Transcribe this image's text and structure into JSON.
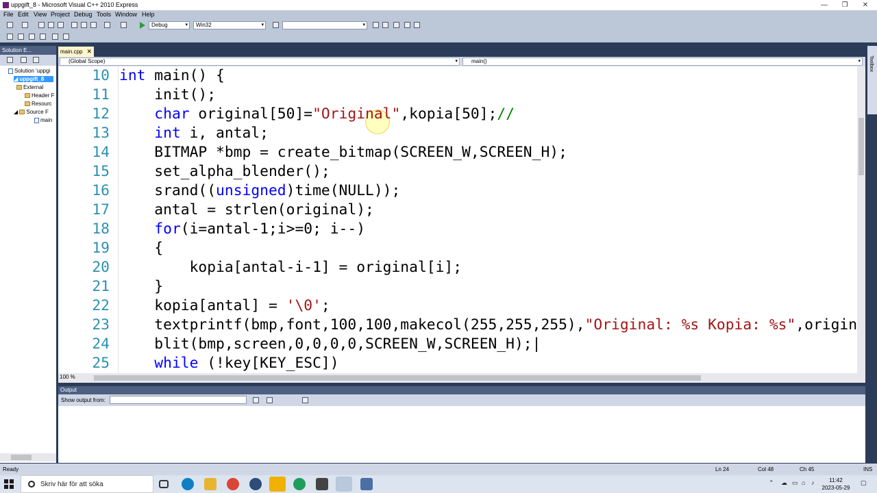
{
  "window": {
    "title": "uppgift_8 - Microsoft Visual C++ 2010 Express",
    "controls": [
      "—",
      "❐",
      "✕"
    ]
  },
  "menu": [
    "File",
    "Edit",
    "View",
    "Project",
    "Debug",
    "Tools",
    "Window",
    "Help"
  ],
  "toolbar": {
    "config": "Debug",
    "platform": "Win32",
    "find_value": ""
  },
  "solution_explorer": {
    "title": "Solution E...",
    "items": [
      {
        "label": "Solution 'uppgi",
        "kind": "solution"
      },
      {
        "label": "uppgift_8",
        "kind": "project"
      },
      {
        "label": "External",
        "kind": "folder"
      },
      {
        "label": "Header F",
        "kind": "folder"
      },
      {
        "label": "Resourc",
        "kind": "folder"
      },
      {
        "label": "Source F",
        "kind": "folder"
      },
      {
        "label": "main",
        "kind": "file"
      }
    ]
  },
  "editor": {
    "tab": "main.cpp",
    "scope": "(Global Scope)",
    "function": "main()",
    "zoom": "100 %",
    "lines": [
      {
        "n": "10",
        "tokens": [
          {
            "t": "int",
            "c": "kw"
          },
          {
            "t": " main() {",
            "c": ""
          }
        ]
      },
      {
        "n": "11",
        "tokens": [
          {
            "t": "    init();",
            "c": ""
          }
        ]
      },
      {
        "n": "12",
        "tokens": [
          {
            "t": "    ",
            "c": ""
          },
          {
            "t": "char",
            "c": "kw"
          },
          {
            "t": " original[50]=",
            "c": ""
          },
          {
            "t": "\"Original\"",
            "c": "str"
          },
          {
            "t": ",kopia[50];",
            "c": ""
          },
          {
            "t": "//",
            "c": "cm"
          }
        ]
      },
      {
        "n": "13",
        "tokens": [
          {
            "t": "    ",
            "c": ""
          },
          {
            "t": "int",
            "c": "kw"
          },
          {
            "t": " i, antal;",
            "c": ""
          }
        ]
      },
      {
        "n": "14",
        "tokens": [
          {
            "t": "    BITMAP *bmp = create_bitmap(SCREEN_W,SCREEN_H);",
            "c": ""
          }
        ]
      },
      {
        "n": "15",
        "tokens": [
          {
            "t": "    set_alpha_blender();",
            "c": ""
          }
        ]
      },
      {
        "n": "16",
        "tokens": [
          {
            "t": "    srand((",
            "c": ""
          },
          {
            "t": "unsigned",
            "c": "kw"
          },
          {
            "t": ")time(NULL));",
            "c": ""
          }
        ]
      },
      {
        "n": "17",
        "tokens": [
          {
            "t": "    antal = strlen(original);",
            "c": ""
          }
        ]
      },
      {
        "n": "18",
        "tokens": [
          {
            "t": "    ",
            "c": ""
          },
          {
            "t": "for",
            "c": "kw"
          },
          {
            "t": "(i=antal-1;i>=0; i--)",
            "c": ""
          }
        ]
      },
      {
        "n": "19",
        "tokens": [
          {
            "t": "    {",
            "c": ""
          }
        ]
      },
      {
        "n": "20",
        "tokens": [
          {
            "t": "        kopia[antal-i-1] = original[i];",
            "c": ""
          }
        ]
      },
      {
        "n": "21",
        "tokens": [
          {
            "t": "    }",
            "c": ""
          }
        ]
      },
      {
        "n": "22",
        "tokens": [
          {
            "t": "    kopia[antal] = ",
            "c": ""
          },
          {
            "t": "'\\0'",
            "c": "str"
          },
          {
            "t": ";",
            "c": ""
          }
        ]
      },
      {
        "n": "23",
        "tokens": [
          {
            "t": "    textprintf(bmp,font,100,100,makecol(255,255,255),",
            "c": ""
          },
          {
            "t": "\"Original: %s Kopia: %s\"",
            "c": "str"
          },
          {
            "t": ",origina",
            "c": ""
          }
        ]
      },
      {
        "n": "24",
        "tokens": [
          {
            "t": "    blit(bmp,screen,0,0,0,0,SCREEN_W,SCREEN_H);|",
            "c": ""
          }
        ]
      },
      {
        "n": "25",
        "tokens": [
          {
            "t": "    ",
            "c": ""
          },
          {
            "t": "while",
            "c": "kw"
          },
          {
            "t": " (!key[KEY_ESC])",
            "c": ""
          }
        ]
      }
    ]
  },
  "output": {
    "title": "Output",
    "show_from_label": "Show output from:"
  },
  "side_strip": "Toolbox",
  "status": {
    "state": "Ready",
    "line": "Ln 24",
    "col": "Col 48",
    "ch": "Ch 45",
    "mode": "INS"
  },
  "taskbar": {
    "search_placeholder": "Skriv här för att söka",
    "time": "11:42",
    "date": "2023-05-29"
  },
  "colors": {
    "keyword": "#0000ff",
    "string": "#a31515",
    "comment": "#008000",
    "line_number": "#2b91af",
    "chrome": "#2b3c59"
  }
}
